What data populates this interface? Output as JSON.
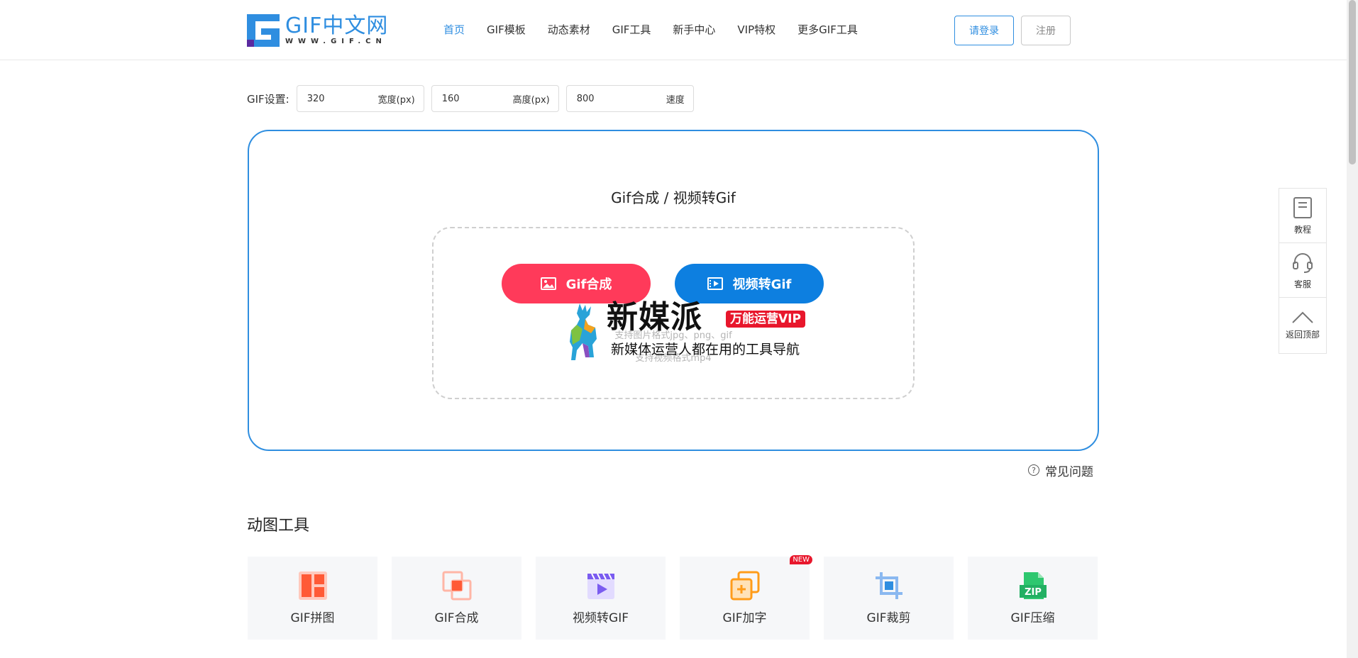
{
  "header": {
    "logo": {
      "title": "GIF中文网",
      "subtitle": "WWW.GIF.CN"
    },
    "nav": [
      "首页",
      "GIF模板",
      "动态素材",
      "GIF工具",
      "新手中心",
      "VIP特权",
      "更多GIF工具"
    ],
    "login_label": "请登录",
    "register_label": "注册"
  },
  "settings": {
    "label": "GIF设置:",
    "width": {
      "value": "320",
      "unit": "宽度(px)"
    },
    "height": {
      "value": "160",
      "unit": "高度(px)"
    },
    "speed": {
      "value": "800",
      "unit": "速度"
    }
  },
  "main": {
    "title": "Gif合成 / 视频转Gif",
    "gif_button": "Gif合成",
    "video_button": "视频转Gif",
    "hint_image": "支持图片格式jpg、png、gif",
    "hint_video": "支持视频格式mp4",
    "faq": "常见问题"
  },
  "watermark": {
    "title": "新媒派",
    "badge": "万能运营VIP",
    "subtitle": "新媒体运营人都在用的工具导航"
  },
  "tools": {
    "heading": "动图工具",
    "items": [
      {
        "label": "GIF拼图",
        "icon": "grid-icon"
      },
      {
        "label": "GIF合成",
        "icon": "merge-icon"
      },
      {
        "label": "视频转GIF",
        "icon": "video-icon"
      },
      {
        "label": "GIF加字",
        "icon": "add-text-icon",
        "badge": "NEW"
      },
      {
        "label": "GIF裁剪",
        "icon": "crop-icon"
      },
      {
        "label": "GIF压缩",
        "icon": "zip-icon",
        "zip_text": "ZIP"
      }
    ]
  },
  "side_panel": {
    "items": [
      {
        "label": "教程",
        "icon": "book-icon"
      },
      {
        "label": "客服",
        "icon": "headset-icon"
      },
      {
        "label": "返回顶部",
        "icon": "chevron-up-icon"
      }
    ]
  },
  "colors": {
    "brand_blue": "#2f8ee0",
    "gif_button": "#ff3a5a",
    "video_button": "#0d7fe0",
    "badge_red": "#e8172c"
  }
}
